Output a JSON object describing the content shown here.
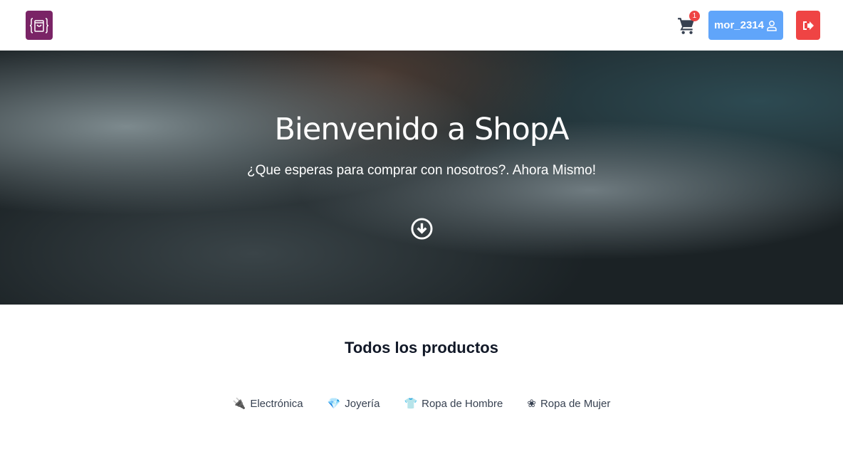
{
  "nav": {
    "cart_count": "1",
    "username": "mor_2314"
  },
  "hero": {
    "title": "Bienvenido a ShopA",
    "subtitle": "¿Que esperas para comprar con nosotros?. Ahora Mismo!"
  },
  "products": {
    "heading": "Todos los productos",
    "categories": [
      {
        "label": "Electrónica",
        "icon": "electronics-icon"
      },
      {
        "label": "Joyería",
        "icon": "gem-icon"
      },
      {
        "label": "Ropa de Hombre",
        "icon": "shirt-icon"
      },
      {
        "label": "Ropa de Mujer",
        "icon": "flower-icon"
      }
    ]
  }
}
